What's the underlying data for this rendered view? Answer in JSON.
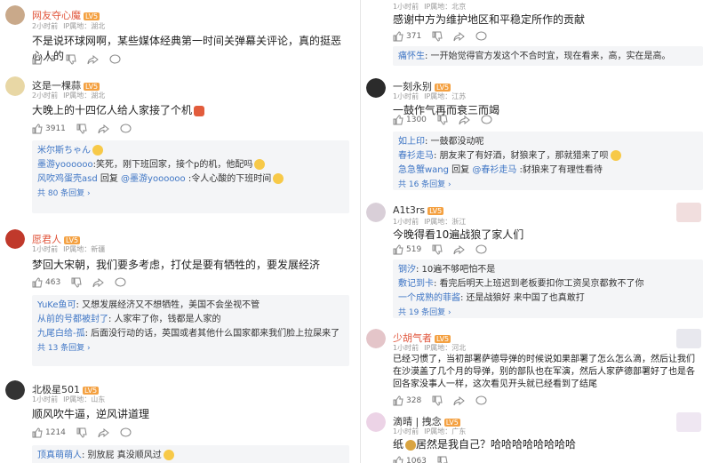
{
  "left": [
    {
      "user": "网友夺心魔",
      "level": "LV5",
      "time": "2小时前",
      "region": "IP属地：湖北",
      "text": "不是说环球网啊，某些媒体经典第一时间关弹幕关评论，真的挺恶心人的",
      "likes": "73"
    },
    {
      "user": "这是一棵蒜",
      "level": "LV5",
      "time": "2小时前",
      "region": "IP属地：湖北",
      "text": "大晚上的十四亿人给人家接了个机",
      "likes": "3911",
      "replies": [
        {
          "name": "米尔斯ちゃん",
          "text": ":"
        },
        {
          "name": "墨游yoooooo",
          "text": ":笑死，刚下班回家，接个p的机，他配吗"
        },
        {
          "name": "风吹鸡蛋壳asd",
          "text": " 回复 ",
          "name2": "@墨游yoooooo",
          "text2": " :令人心酸的下班时间"
        }
      ],
      "more": "共 80 条回复"
    },
    {
      "user": "愿君人",
      "level": "LV5",
      "time": "1小时前",
      "region": "IP属地：新疆",
      "text": "梦回大宋朝，我们要多考虑，打仗是要有牺牲的，要发展经济",
      "likes": "463",
      "replies": [
        {
          "name": "YuKe鱼可",
          "text": ": 又想发展经济又不想牺牲，美国不会坐视不管"
        },
        {
          "name": "从前的号都被封了",
          "text": ": 人家牢了你，钱都是人家的"
        },
        {
          "name": "九尾白给-孤",
          "text": ": 后面没行动的话，英国或者其他什么国家都来我们脸上拉屎来了"
        }
      ],
      "more": "共 13 条回复"
    },
    {
      "user": "北极星501",
      "level": "LV5",
      "time": "1小时前",
      "region": "IP属地：山东",
      "text": "顺风吹牛逼，逆风讲道理",
      "likes": "1214",
      "replies": [
        {
          "name": "顶真萌萌人",
          "text": ": 别放屁 真没顺风过"
        }
      ]
    }
  ],
  "right": [
    {
      "user": "",
      "level": "",
      "time": "1小时前",
      "region": "IP属地：北京",
      "text": "感谢中方为维护地区和平稳定所作的贡献",
      "likes": "371",
      "extra": {
        "name": "痛怀生",
        "text": ": 一开始觉得官方发这个不合时宜，现在看来，高，实在是高。"
      }
    },
    {
      "user": "一刻永别",
      "level": "LV5",
      "time": "1小时前",
      "region": "IP属地：江苏",
      "text": "一鼓作气再而衰三而竭",
      "likes": "1300",
      "replies": [
        {
          "name": "如上印",
          "text": ": 一鼓都没动呢"
        },
        {
          "name": "春衫走马",
          "text": ": 朋友来了有好酒，豺狼来了，那就猎来了呗"
        },
        {
          "name": "急急蟹wang",
          "text": " 回复 ",
          "name2": "@春衫走马",
          "text2": " :豺狼来了有理性看待"
        }
      ],
      "more": "共 16 条回复"
    },
    {
      "user": "A1t3rs",
      "level": "LV5",
      "time": "1小时前",
      "region": "IP属地：浙江",
      "text": "今晚得看10遍战狼了家人们",
      "likes": "519",
      "replies": [
        {
          "name": "钢汐",
          "text": ": 10遍不够吧怕不是"
        },
        {
          "name": "敷记到卡",
          "text": ": 看完后明天上班迟到老板要扣你工资吴京都救不了你"
        },
        {
          "name": "一个成熟的菲酱",
          "text": ": 还是战狼好 来中国了也真敢打"
        }
      ],
      "more": "共 19 条回复"
    },
    {
      "user": "少胡气者",
      "level": "LV5",
      "time": "1小时前",
      "region": "IP属地：河北",
      "text": "已经习惯了，当初部署萨德导弹的时候说如果部署了怎么怎么滴，然后让我们在沙漠盖了几个月的导弹，别的部队也在军演，然后人家萨德部署好了也是各回各家没事人一样，这次看见开头就已经看到了结尾",
      "likes": "328"
    },
    {
      "user": "滴晴 | 拽念",
      "level": "LV5",
      "time": "1小时前",
      "region": "IP属地：广东",
      "text": "纸",
      "text_after": "居然是我自己？哈哈哈哈哈哈哈哈",
      "likes": "1063"
    }
  ],
  "colors": {
    "link": "#3f76c5",
    "level": "#f4a142",
    "reply_bg": "#f4f5f7"
  },
  "icons": [
    "thumb-up-icon",
    "thumb-down-icon",
    "share-icon",
    "comment-icon"
  ]
}
